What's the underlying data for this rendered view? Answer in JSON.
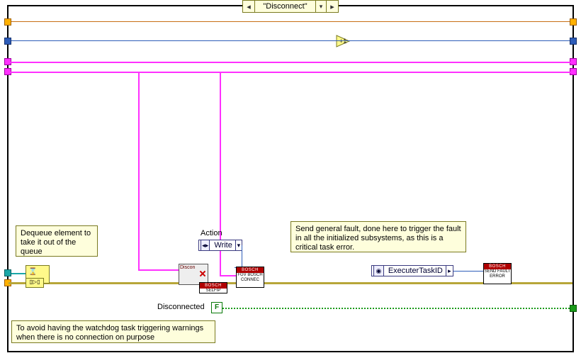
{
  "case": {
    "label": "\"Disconnect\""
  },
  "tips": {
    "dequeue": "Dequeue element to take it out of the queue",
    "watchdog": "To avoid having the watchdog task triggering warnings when there is no connection on purpose",
    "fault": "Send general fault, done here to trigger the fault in all the initialized subsystems, as this is a critical task error."
  },
  "labels": {
    "action": "Action",
    "disconnected": "Disconnected"
  },
  "rings": {
    "write": "Write",
    "executerTaskID": "ExecuterTaskID"
  },
  "inc": {
    "text": "+1"
  },
  "fconst": {
    "text": "F"
  },
  "discon": {
    "text": "Discon"
  },
  "subvi": {
    "hdr": "BOSCH",
    "selfip": "SELFIP",
    "fgv": "FGV BOSCH CONNEC",
    "sendfault": "SEND FAULT ERROR"
  }
}
